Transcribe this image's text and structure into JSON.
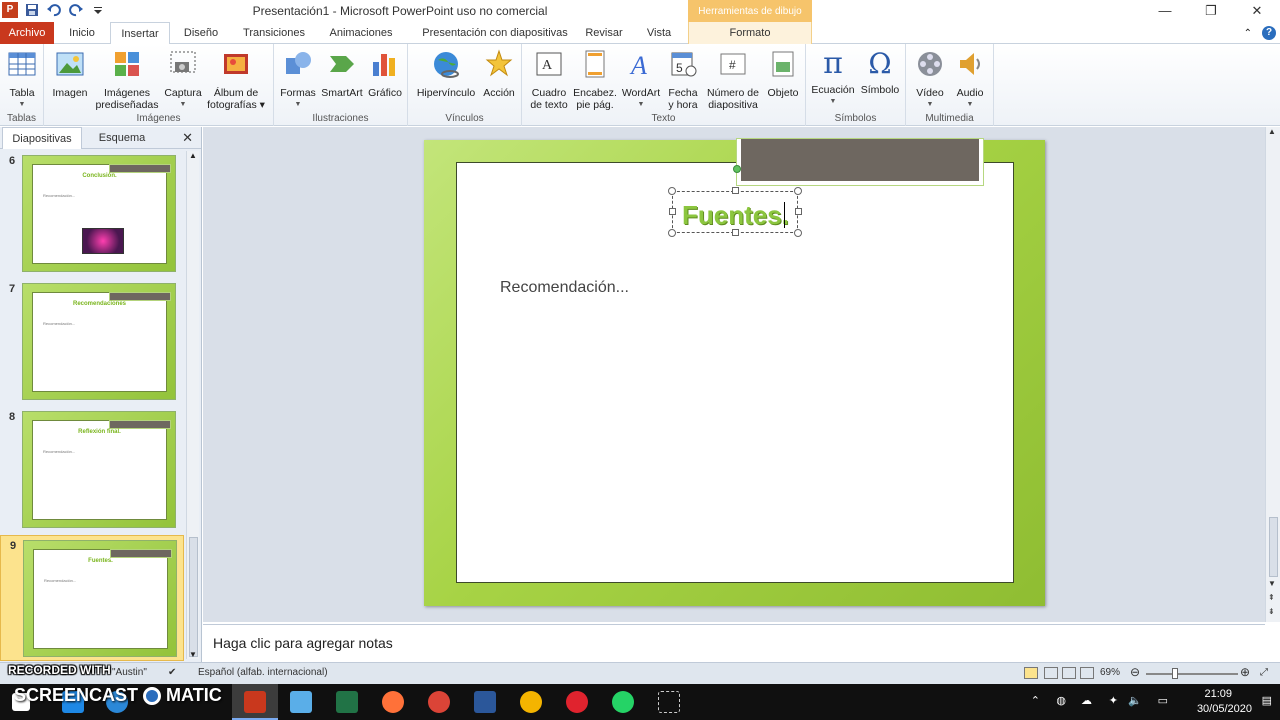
{
  "window": {
    "title": "Presentación1  -  Microsoft PowerPoint uso no comercial",
    "contextual_tab_header": "Herramientas de dibujo",
    "minimize": "—",
    "restore": "❐",
    "close": "✕"
  },
  "tabs": [
    {
      "label": "Archivo"
    },
    {
      "label": "Inicio"
    },
    {
      "label": "Insertar"
    },
    {
      "label": "Diseño"
    },
    {
      "label": "Transiciones"
    },
    {
      "label": "Animaciones"
    },
    {
      "label": "Presentación con diapositivas"
    },
    {
      "label": "Revisar"
    },
    {
      "label": "Vista"
    },
    {
      "label": "Formato"
    }
  ],
  "ribbon": {
    "groups": {
      "tablas": "Tablas",
      "imagenes": "Imágenes",
      "ilustraciones": "Ilustraciones",
      "vinculos": "Vínculos",
      "texto": "Texto",
      "simbolos": "Símbolos",
      "multimedia": "Multimedia"
    },
    "buttons": {
      "tabla": "Tabla",
      "imagen": "Imagen",
      "imagenes_predisenadas_1": "Imágenes",
      "imagenes_predisenadas_2": "prediseñadas",
      "captura": "Captura",
      "album_1": "Álbum de",
      "album_2": "fotografías",
      "formas": "Formas",
      "smartart": "SmartArt",
      "grafico": "Gráfico",
      "hipervinculo": "Hipervínculo",
      "accion": "Acción",
      "cuadro_1": "Cuadro",
      "cuadro_2": "de texto",
      "encabez_1": "Encabez.",
      "encabez_2": "pie pág.",
      "wordart": "WordArt",
      "fecha_1": "Fecha",
      "fecha_2": "y hora",
      "numero_1": "Número de",
      "numero_2": "diapositiva",
      "objeto": "Objeto",
      "ecuacion": "Ecuación",
      "simbolo": "Símbolo",
      "video": "Vídeo",
      "audio": "Audio"
    }
  },
  "left_pane": {
    "tab_slides": "Diapositivas",
    "tab_outline": "Esquema",
    "close": "✕",
    "thumbnails": [
      {
        "number": "6",
        "title": "Conclusión.",
        "text": "Recomendación..."
      },
      {
        "number": "7",
        "title": "Recomendaciones",
        "text": "Recomendación..."
      },
      {
        "number": "8",
        "title": "Reflexión final.",
        "text": "Recomendación..."
      },
      {
        "number": "9",
        "title": "Fuentes.",
        "text": "Recomendación..."
      }
    ]
  },
  "slide": {
    "title": "Fuentes.",
    "body": "Recomendación..."
  },
  "notes": {
    "placeholder": "Haga clic para agregar notas"
  },
  "status_bar": {
    "recorded_with": "RECORDED WITH",
    "theme": "\"Austin\"",
    "language": "Español (alfab. internacional)",
    "zoom": "69%"
  },
  "taskbar": {
    "watermark": "SCREENCAST",
    "watermark2": "MATIC",
    "time": "21:09",
    "date": "30/05/2020"
  }
}
